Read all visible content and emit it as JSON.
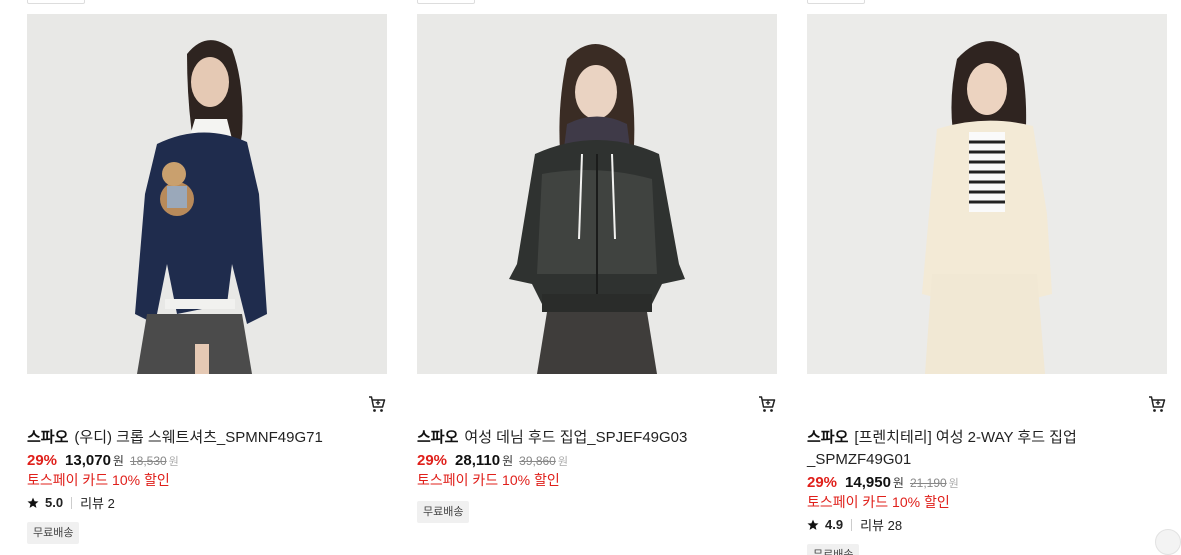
{
  "products": [
    {
      "brand": "스파오",
      "name": "(우디) 크롭 스웨트셔츠_SPMNF49G71",
      "discount": "29%",
      "price": "13,070",
      "currency": "원",
      "original_price": "18,530",
      "promo": "토스페이 카드 10% 할인",
      "rating": "5.0",
      "reviews": "리뷰 2",
      "shipping_badge": "무료배송",
      "image_icon": "navy-sweatshirt-photo"
    },
    {
      "brand": "스파오",
      "name": "여성 데님 후드 집업_SPJEF49G03",
      "discount": "29%",
      "price": "28,110",
      "currency": "원",
      "original_price": "39,860",
      "promo": "토스페이 카드 10% 할인",
      "shipping_badge": "무료배송",
      "image_icon": "denim-hood-jacket-photo"
    },
    {
      "brand": "스파오",
      "name_line1": "[프렌치테리] 여성 2-WAY 후드 집업",
      "name_line2": "_SPMZF49G01",
      "discount": "29%",
      "price": "14,950",
      "currency": "원",
      "original_price": "21,190",
      "promo": "토스페이 카드 10% 할인",
      "rating": "4.9",
      "reviews": "리뷰 28",
      "shipping_badge": "무료배송",
      "image_icon": "cream-hood-zipup-photo"
    }
  ],
  "colors": {
    "discount": "#e0201b",
    "promo": "#e0201b",
    "badge_bg": "#f0f0f0"
  }
}
